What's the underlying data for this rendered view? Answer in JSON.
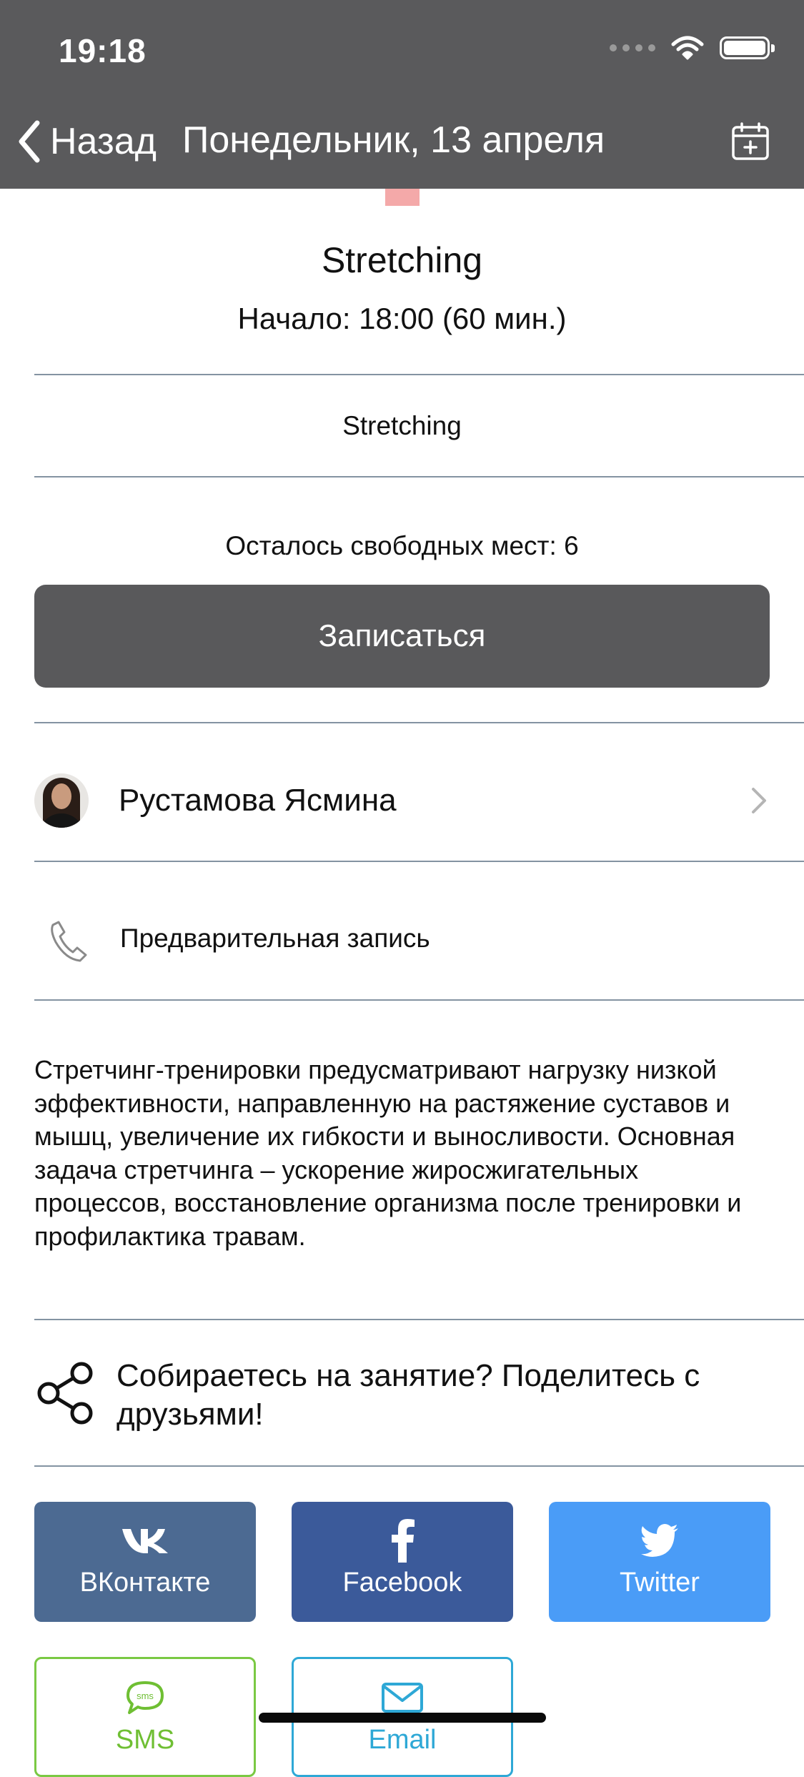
{
  "status_bar": {
    "time": "19:18"
  },
  "nav": {
    "back_label": "Назад",
    "title": "Понедельник, 13 апреля"
  },
  "class": {
    "title": "Stretching",
    "start": "Начало: 18:00 (60 мин.)",
    "category": "Stretching",
    "free_seats": "Осталось свободных мест: 6",
    "signup_label": "Записаться"
  },
  "trainer": {
    "name": "Рустамова Ясмина"
  },
  "booking": {
    "label": "Предварительная запись"
  },
  "description": "Стретчинг-тренировки предусматривают нагрузку низкой эффективности, направленную на растяжение суставов и мышц, увеличение их гибкости и выносливости. Основная задача стретчинга – ускорение жиросжигательных процессов, восстановление организма после тренировки и профилактика травам.",
  "share": {
    "text": "Собираетесь на занятие? Поделитесь с друзьями!",
    "buttons": [
      {
        "label": "ВКонтакте",
        "icon": "vk-icon",
        "color": "#4c6a92"
      },
      {
        "label": "Facebook",
        "icon": "facebook-icon",
        "color": "#3b5a9a"
      },
      {
        "label": "Twitter",
        "icon": "twitter-icon",
        "color": "#4a9cf7"
      },
      {
        "label": "SMS",
        "icon": "sms-icon",
        "color": "#7ac943"
      },
      {
        "label": "Email",
        "icon": "email-icon",
        "color": "#2ea8d6"
      }
    ]
  },
  "colors": {
    "header": "#5a5a5c",
    "button": "#59595b",
    "accent_mark": "#f4a9a9"
  }
}
